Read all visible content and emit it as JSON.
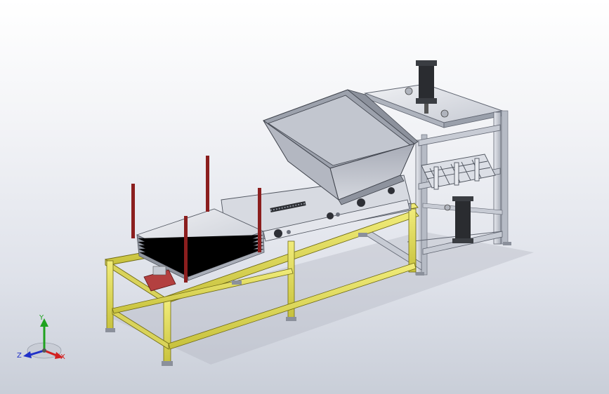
{
  "view": {
    "background_top": "#ffffff",
    "background_bottom": "#c9ced8"
  },
  "colors": {
    "frame_yellow": "#e6e05a",
    "frame_yellow_dark": "#9b9626",
    "frame_grey": "#cfd3dc",
    "frame_grey_dark": "#6f7480",
    "hopper": "#b9bdc8",
    "hopper_dark": "#7f8490",
    "post_red": "#8b1e1e",
    "cylinder": "#2a2c30",
    "axis_x": "#d22020",
    "axis_y": "#1fa21f",
    "axis_z": "#2030c8"
  },
  "triad": {
    "x_label": "X",
    "y_label": "Y",
    "z_label": "Z"
  }
}
